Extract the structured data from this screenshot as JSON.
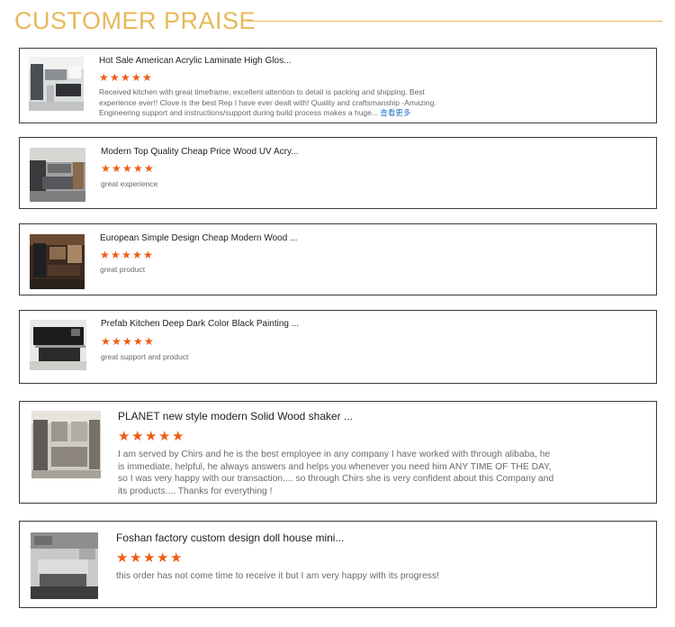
{
  "header": {
    "title": "CUSTOMER PRAISE",
    "accent_color": "#e7b85a"
  },
  "star_color": "#ef5b13",
  "star_glyph": "★",
  "reviews": [
    {
      "title": "Hot Sale American Acrylic Laminate High Glos...",
      "rating": 5,
      "text": "Received kitchen with great timeframe, excellent attention to detail is packing and shipping.  Best experience ever!! Clove is the best Rep I have ever dealt with!  Quality and craftsmanship -Amazing.  Engineering support and instructions/support during build process makes a huge...",
      "more_label": "查看更多",
      "image_icon": "white-kitchen-photo"
    },
    {
      "title": "Modern Top Quality Cheap Price Wood UV Acry...",
      "rating": 5,
      "text": "great experience",
      "image_icon": "grey-kitchen-photo"
    },
    {
      "title": "European Simple Design Cheap Modern Wood ...",
      "rating": 5,
      "text": "great product",
      "image_icon": "dark-wood-kitchen-photo"
    },
    {
      "title": "Prefab Kitchen Deep Dark Color Black Painting ...",
      "rating": 5,
      "text": "great support and product",
      "image_icon": "black-kitchen-photo"
    },
    {
      "title": "PLANET new style modern Solid Wood shaker ...",
      "rating": 5,
      "text": "I am served by Chirs and he is the best employee in any company I have worked with through alibaba, he is immediate, helpful, he always answers and helps you whenever you need him ANY TIME OF THE DAY, so I was very happy with our transaction....  so through Chirs she is very confident about this Company and its products....  Thanks for everything !",
      "image_icon": "shaker-kitchen-photo"
    },
    {
      "title": "Foshan factory custom design doll house mini...",
      "rating": 5,
      "text": "this order has not come time to receive it but I am very happy with its progress!",
      "image_icon": "grey-island-kitchen-photo"
    }
  ]
}
